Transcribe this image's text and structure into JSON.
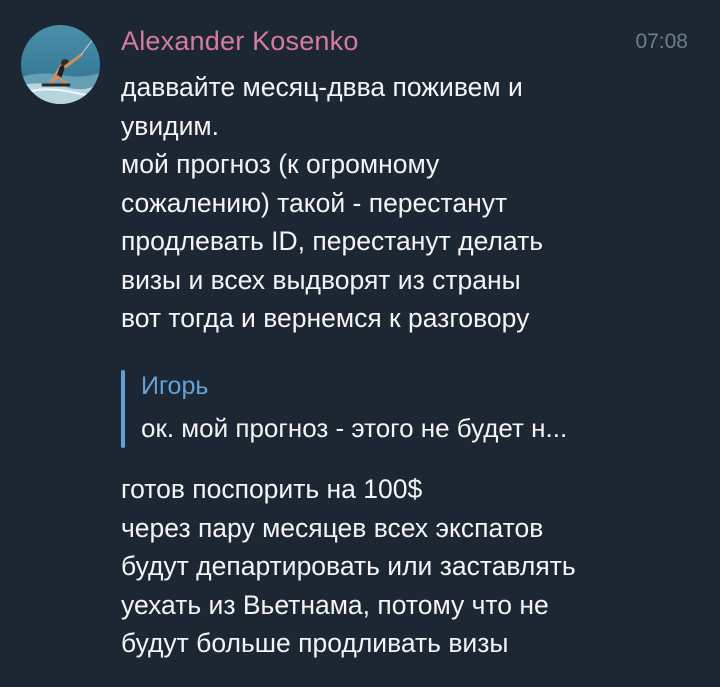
{
  "message": {
    "sender": "Alexander Kosenko",
    "time": "07:08",
    "avatar_icon": "kitesurfer-photo-avatar",
    "text_lines_1": [
      "даввайте месяц-двва поживем и",
      "увидим.",
      "мой прогноз (к огромному",
      "сожалению) такой - перестанут",
      "продлевать ID, перестанут делать",
      "визы и всех выдворят из страны",
      "вот тогда и вернемся к разговору"
    ],
    "reply": {
      "author": "Игорь",
      "preview": "ок. мой прогноз - этого не будет н..."
    },
    "text_lines_2": [
      "готов поспорить на 100$",
      "через пару месяцев всех экспатов",
      "будут департировать или заставлять",
      "уехать из Вьетнама, потому что не",
      "будут больше продливать визы"
    ]
  },
  "colors": {
    "background": "#1d2733",
    "sender_name": "#d57ba0",
    "timestamp": "#6d7f8f",
    "message_text": "#f4f4f4",
    "reply_accent": "#5fa1d8"
  }
}
